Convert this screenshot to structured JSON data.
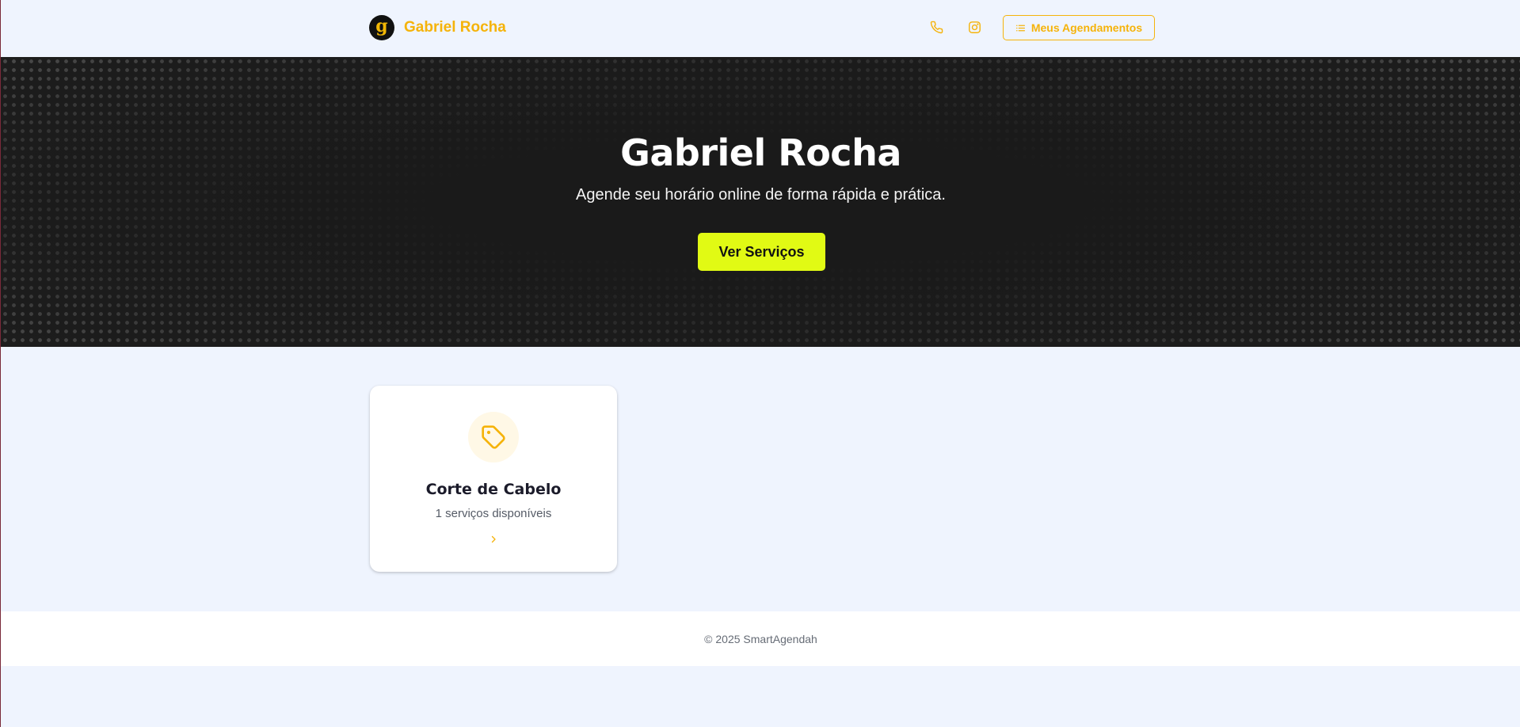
{
  "header": {
    "brand_logo_letter": "g",
    "brand_name": "Gabriel Rocha",
    "appointments_label": "Meus Agendamentos",
    "icons": {
      "phone": "phone-icon",
      "instagram": "instagram-icon",
      "list": "list-icon"
    }
  },
  "hero": {
    "title": "Gabriel Rocha",
    "subtitle": "Agende seu horário online de forma rápida e prática.",
    "button_label": "Ver Serviços"
  },
  "categories": [
    {
      "icon": "tag-icon",
      "title": "Corte de Cabelo",
      "subtitle": "1 serviços disponíveis"
    }
  ],
  "footer": {
    "text": "© 2025 SmartAgendah"
  },
  "colors": {
    "accent": "#f5b30a",
    "cta": "#e1fa14",
    "background": "#eff4fe",
    "hero_bg": "#1d1d1d"
  }
}
